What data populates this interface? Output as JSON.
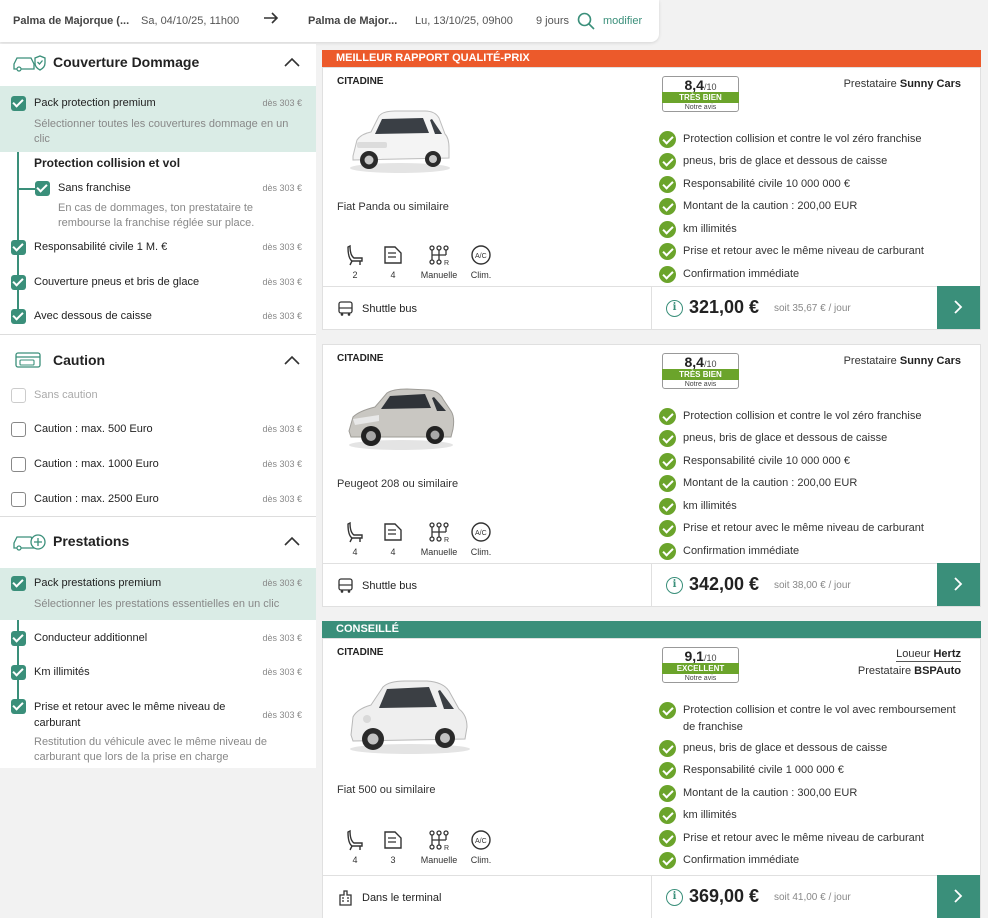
{
  "search": {
    "pickup_location": "Palma de Majorque (...",
    "pickup_date": "Sa, 04/10/25, 11h00",
    "dropoff_location": "Palma de Major...",
    "dropoff_date": "Lu, 13/10/25, 09h00",
    "duration": "9 jours",
    "modify_label": "modifier"
  },
  "sidebar": {
    "coverage": {
      "title": "Couverture Dommage",
      "premium_label": "Pack protection premium",
      "premium_price": "dès 303 €",
      "premium_desc": "Sélectionner toutes les couvertures dommage en un clic",
      "collision_heading": "Protection collision et vol",
      "no_excess_label": "Sans franchise",
      "no_excess_price": "dès 303 €",
      "no_excess_desc": "En cas de dommages, ton prestataire te rembourse la franchise réglée sur place.",
      "liability_label": "Responsabilité civile 1 M. €",
      "liability_price": "dès 303 €",
      "tires_label": "Couverture pneus et bris de glace",
      "tires_price": "dès 303 €",
      "underbody_label": "Avec dessous de caisse",
      "underbody_price": "dès 303 €"
    },
    "deposit": {
      "title": "Caution",
      "items": [
        {
          "label": "Sans caution",
          "price": ""
        },
        {
          "label": "Caution : max. 500 Euro",
          "price": "dès 303 €"
        },
        {
          "label": "Caution : max. 1000 Euro",
          "price": "dès 303 €"
        },
        {
          "label": "Caution : max. 2500 Euro",
          "price": "dès 303 €"
        }
      ]
    },
    "services": {
      "title": "Prestations",
      "premium_label": "Pack prestations premium",
      "premium_price": "dès 303 €",
      "premium_desc": "Sélectionner les prestations essentielles en un clic",
      "driver_label": "Conducteur additionnel",
      "driver_price": "dès 303 €",
      "km_label": "Km illimités",
      "km_price": "dès 303 €",
      "fuel_label": "Prise et retour avec le même niveau de carburant",
      "fuel_price": "dès 303 €",
      "fuel_desc": "Restitution du véhicule avec le même niveau de carburant que lors de la prise en charge"
    }
  },
  "offers": [
    {
      "banner": "MEILLEUR RAPPORT QUALITÉ-PRIX",
      "category": "CITADINE",
      "model": "Fiat Panda ou similaire",
      "seats": "2",
      "bags": "4",
      "transmission": "Manuelle",
      "ac": "Clim.",
      "score": "8,4",
      "score_max": "/10",
      "verdict": "TRÈS BIEN",
      "avis": "Notre avis",
      "provider_label": "Prestataire",
      "provider": "Sunny Cars",
      "features": [
        "Protection collision et contre le vol zéro franchise",
        "pneus, bris de glace et dessous de caisse",
        "Responsabilité civile 10 000 000 €",
        "Montant de la caution : 200,00 EUR",
        "km illimités",
        "Prise et retour avec le même niveau de carburant",
        "Confirmation immédiate"
      ],
      "pickup": "Shuttle bus",
      "price": "321,00 €",
      "per_day": "soit 35,67 € / jour"
    },
    {
      "category": "CITADINE",
      "model": "Peugeot 208 ou similaire",
      "seats": "4",
      "bags": "4",
      "transmission": "Manuelle",
      "ac": "Clim.",
      "score": "8,4",
      "score_max": "/10",
      "verdict": "TRÈS BIEN",
      "avis": "Notre avis",
      "provider_label": "Prestataire",
      "provider": "Sunny Cars",
      "features": [
        "Protection collision et contre le vol zéro franchise",
        "pneus, bris de glace et dessous de caisse",
        "Responsabilité civile 10 000 000 €",
        "Montant de la caution : 200,00 EUR",
        "km illimités",
        "Prise et retour avec le même niveau de carburant",
        "Confirmation immédiate"
      ],
      "pickup": "Shuttle bus",
      "price": "342,00 €",
      "per_day": "soit 38,00 € / jour"
    },
    {
      "banner": "CONSEILLÉ",
      "category": "CITADINE",
      "model": "Fiat 500 ou similaire",
      "seats": "4",
      "bags": "3",
      "transmission": "Manuelle",
      "ac": "Clim.",
      "score": "9,1",
      "score_max": "/10",
      "verdict": "EXCELLENT",
      "avis": "Notre avis",
      "renter_label": "Loueur",
      "renter": "Hertz",
      "provider_label": "Prestataire",
      "provider": "BSPAuto",
      "features": [
        "Protection collision et contre le vol avec remboursement de franchise",
        "pneus, bris de glace et dessous de caisse",
        "Responsabilité civile 1 000 000 €",
        "Montant de la caution : 300,00 EUR",
        "km illimités",
        "Prise et retour avec le même niveau de carburant",
        "Confirmation immédiate"
      ],
      "pickup": "Dans le terminal",
      "price": "369,00 €",
      "per_day": "soit 41,00 € / jour"
    }
  ],
  "colors": {
    "brand_green": "#3a8f7a",
    "check_green": "#6ba42b",
    "best_value_banner": "#ec5a2b",
    "recommended_banner": "#3a8f7a",
    "highlight_row": "#daece6"
  }
}
